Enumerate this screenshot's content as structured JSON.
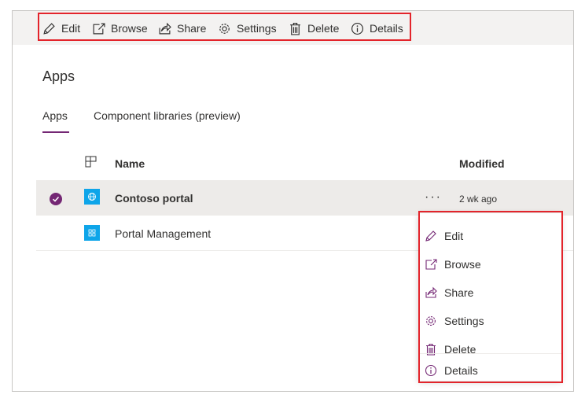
{
  "commandbar": {
    "items": [
      {
        "label": "Edit",
        "icon": "pencil-icon"
      },
      {
        "label": "Browse",
        "icon": "open-in-new-icon"
      },
      {
        "label": "Share",
        "icon": "share-icon"
      },
      {
        "label": "Settings",
        "icon": "gear-icon"
      },
      {
        "label": "Delete",
        "icon": "trash-icon"
      },
      {
        "label": "Details",
        "icon": "info-icon"
      }
    ]
  },
  "page": {
    "title": "Apps",
    "tabs": [
      {
        "label": "Apps",
        "active": true
      },
      {
        "label": "Component libraries (preview)",
        "active": false
      }
    ]
  },
  "table": {
    "headers": {
      "name": "Name",
      "modified": "Modified"
    },
    "rows": [
      {
        "name": "Contoso portal",
        "modified": "2 wk ago",
        "selected": true
      },
      {
        "name": "Portal Management",
        "modified": "",
        "selected": false
      }
    ],
    "more_label": "···"
  },
  "context_menu": {
    "items": [
      {
        "label": "Edit",
        "icon": "pencil-icon"
      },
      {
        "label": "Browse",
        "icon": "open-in-new-icon"
      },
      {
        "label": "Share",
        "icon": "share-icon"
      },
      {
        "label": "Settings",
        "icon": "gear-icon"
      },
      {
        "label": "Delete",
        "icon": "trash-icon"
      },
      {
        "label": "Details",
        "icon": "info-icon"
      }
    ]
  },
  "colors": {
    "accent": "#742774",
    "highlight": "#e3242b",
    "app_icon": "#0ea5e9"
  }
}
